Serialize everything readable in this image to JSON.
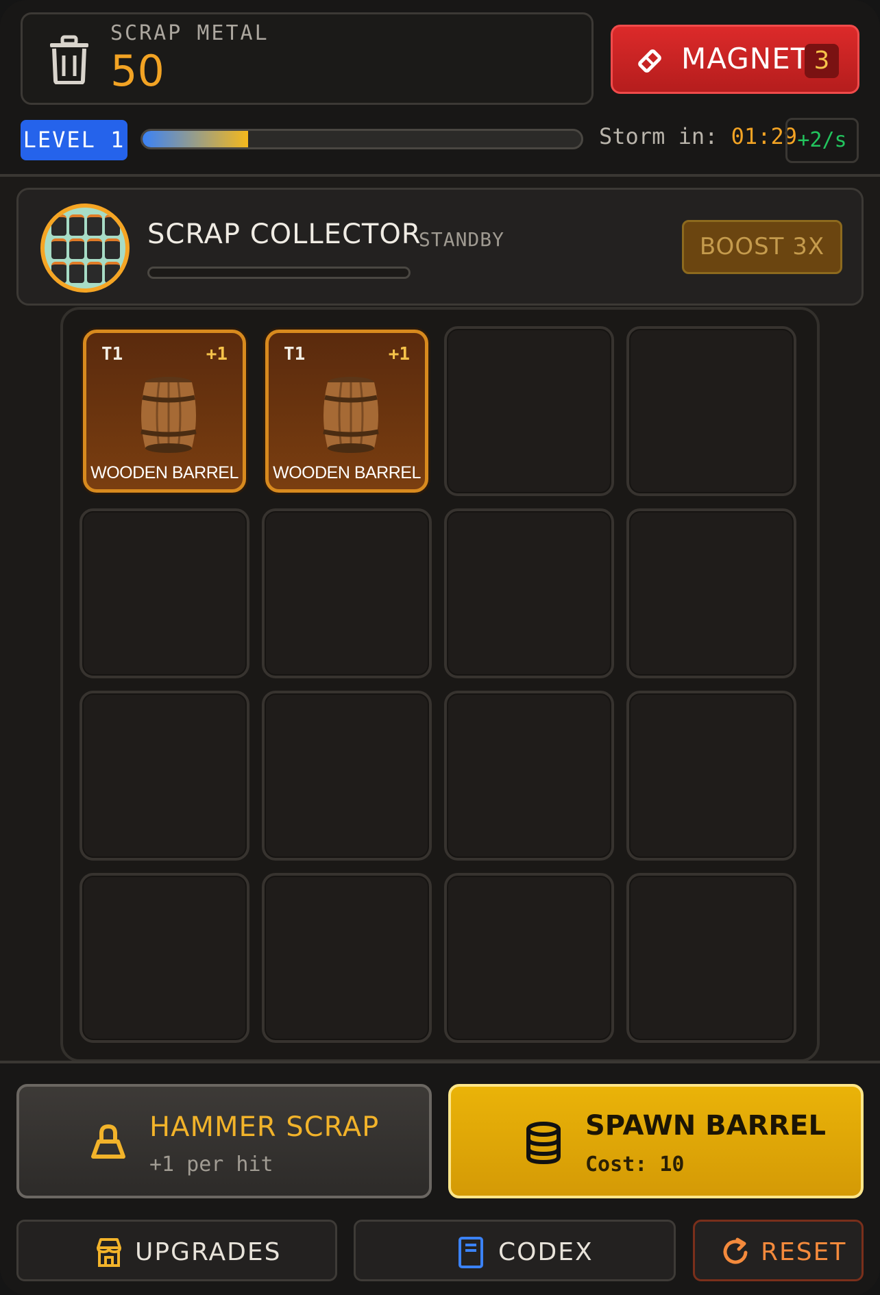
{
  "resources": {
    "scrap_label": "SCRAP METAL",
    "scrap_value": "50"
  },
  "magnet": {
    "label": "MAGNET",
    "count": "3"
  },
  "level": {
    "label": "LEVEL 1",
    "xp_progress": 0.24
  },
  "storm": {
    "label": "Storm in:",
    "time": "01:29"
  },
  "rate": "+2/s",
  "collector": {
    "title": "SCRAP COLLECTOR",
    "status": "STANDBY",
    "boost_label": "BOOST 3X",
    "progress": 0
  },
  "grid": {
    "cells": [
      {
        "tier": "T1",
        "bonus": "+1",
        "name": "WOODEN BARREL"
      },
      {
        "tier": "T1",
        "bonus": "+1",
        "name": "WOODEN BARREL"
      }
    ]
  },
  "actions": {
    "hammer_title": "HAMMER SCRAP",
    "hammer_sub": "+1 per hit",
    "spawn_title": "SPAWN BARREL",
    "spawn_sub": "Cost: 10"
  },
  "nav": {
    "upgrades": "UPGRADES",
    "codex": "CODEX",
    "reset": "RESET"
  },
  "colors": {
    "accent_orange": "#f2a324",
    "magnet_red": "#dc2a2a",
    "level_blue": "#2563eb",
    "spawn_gold": "#eab308",
    "rate_green": "#22c55e"
  }
}
